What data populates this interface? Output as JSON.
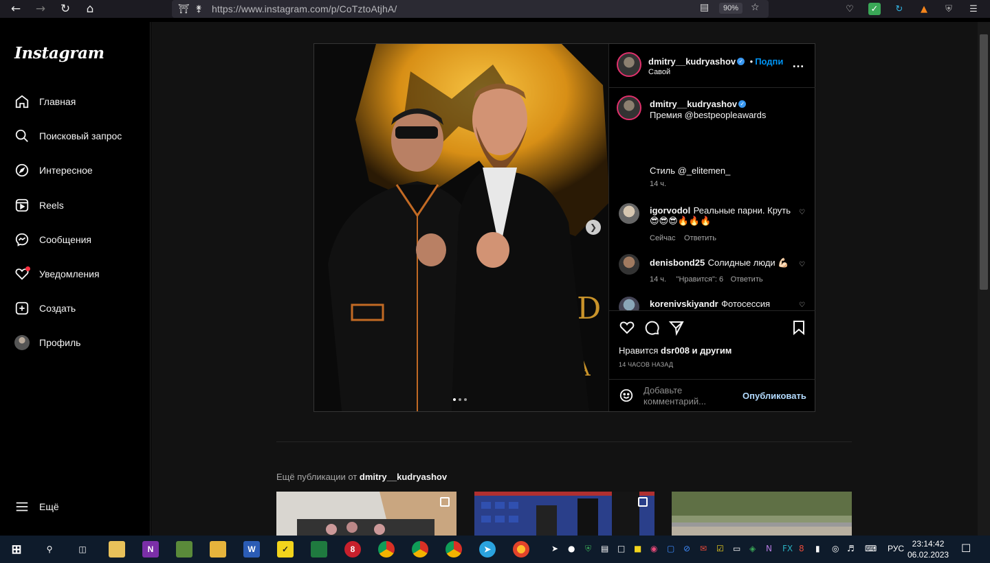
{
  "browser": {
    "url": "https://www.instagram.com/p/CoTztoAtjhA/",
    "zoom": "90%"
  },
  "sidebar": {
    "logo": "Instagram",
    "items": [
      {
        "label": "Главная",
        "icon": "home-icon"
      },
      {
        "label": "Поисковый запрос",
        "icon": "search-icon"
      },
      {
        "label": "Интересное",
        "icon": "compass-icon"
      },
      {
        "label": "Reels",
        "icon": "reels-icon"
      },
      {
        "label": "Сообщения",
        "icon": "messenger-icon"
      },
      {
        "label": "Уведомления",
        "icon": "heart-icon"
      },
      {
        "label": "Создать",
        "icon": "plus-square-icon"
      },
      {
        "label": "Профиль",
        "icon": "profile-avatar"
      }
    ],
    "more": "Ещё"
  },
  "post": {
    "author": "dmitry__kudryashov",
    "follow": "Подпи",
    "location": "Савой",
    "caption_line1": "Премия @bestpeopleawards",
    "caption_line2": "Стиль @_elitemen_",
    "caption_time": "14 ч.",
    "comments": [
      {
        "user": "igorvodol",
        "text": "Реальные парни. Круть",
        "emoji": "😎😎😎🔥🔥🔥",
        "time": "Сейчас",
        "likes": "",
        "reply": "Ответить"
      },
      {
        "user": "denisbond25",
        "text": "Солидные люди 💪🏻",
        "emoji": "",
        "time": "14 ч.",
        "likes": "\"Нравится\": 6",
        "reply": "Ответить"
      },
      {
        "user": "korenivskiyandr",
        "text": "Фотосессия",
        "emoji": "",
        "time": "",
        "likes": "",
        "reply": ""
      }
    ],
    "likes_prefix": "Нравится",
    "likes_user": "dsr008",
    "likes_suffix": "и другим",
    "posted_ago": "14 ЧАСОВ НАЗАД",
    "comment_placeholder": "Добавьте комментарий...",
    "publish": "Опубликовать"
  },
  "more_posts": {
    "prefix": "Ещё публикации от",
    "user": "dmitry__kudryashov"
  },
  "taskbar": {
    "lang": "РУС",
    "time": "23:14:42",
    "date": "06.02.2023"
  },
  "colors": {
    "accent": "#0095f6",
    "background": "#121212",
    "border": "#262626"
  }
}
